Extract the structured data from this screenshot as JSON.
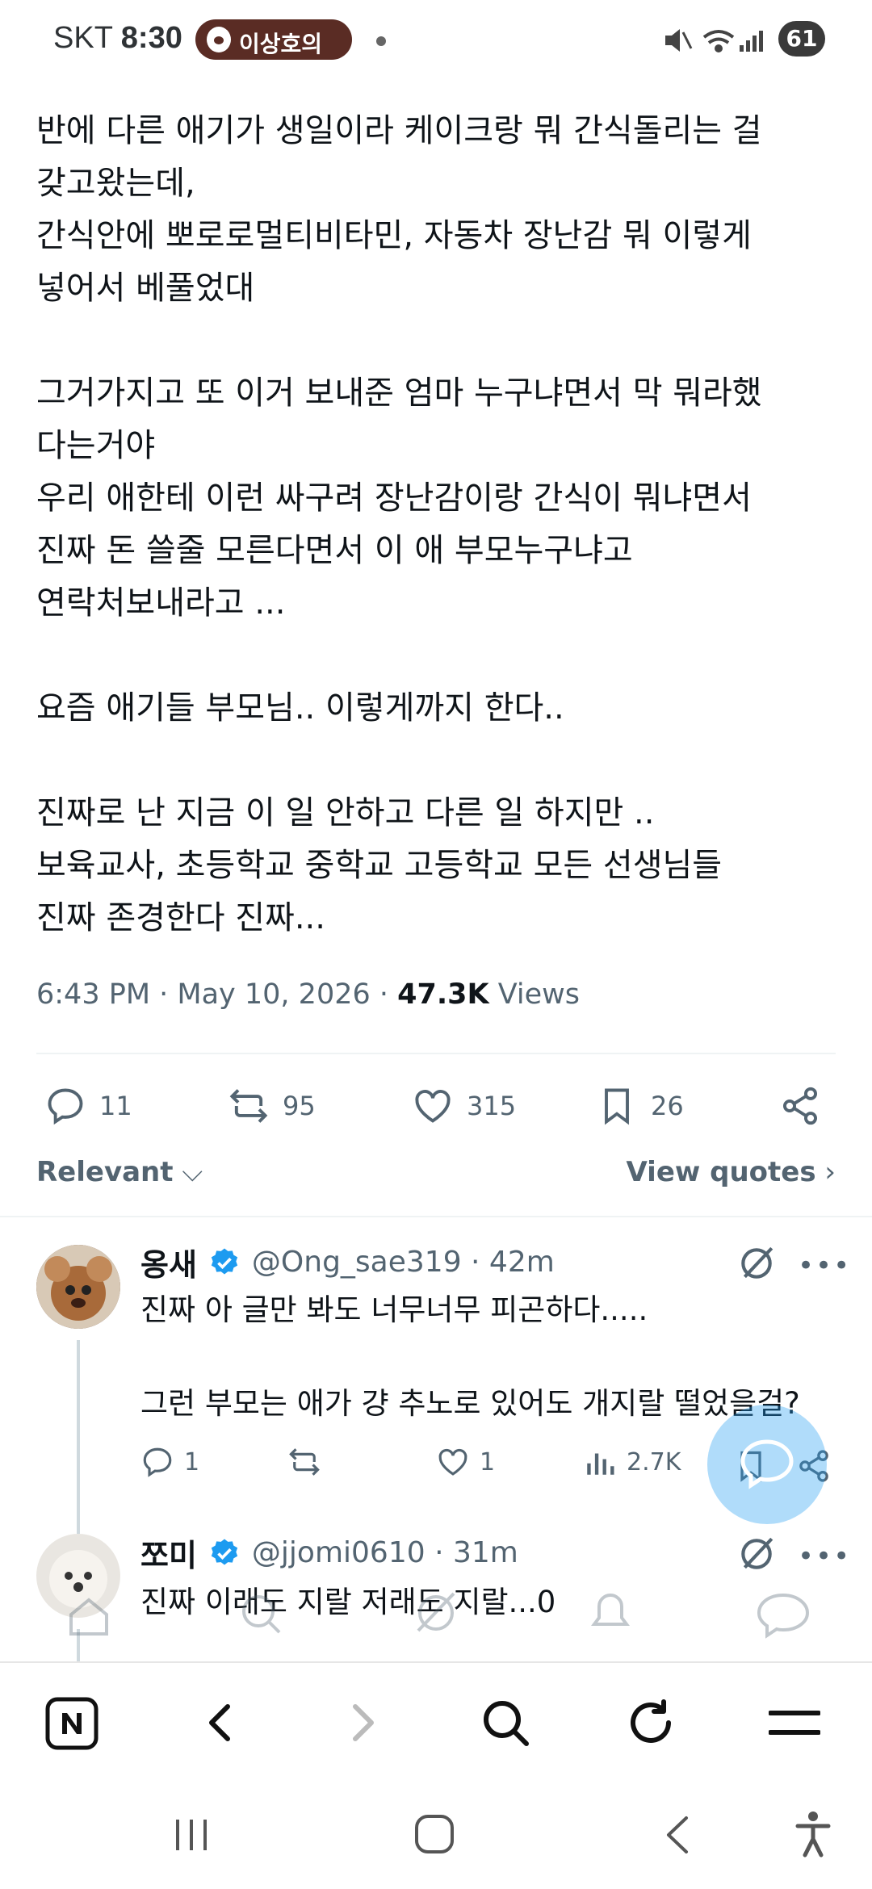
{
  "status_bar": {
    "carrier": "SKT",
    "time": "8:30",
    "notification_pill": "이상호의",
    "battery": "61"
  },
  "tweet": {
    "text": "반에 다른 애기가 생일이라 케이크랑 뭐 간식돌리는 걸\n갖고왔는데,\n간식안에 뽀로로멀티비타민, 자동차 장난감 뭐 이렇게\n넣어서 베풀었대\n\n그거가지고 또 이거 보내준 엄마 누구냐면서 막 뭐라했\n다는거야\n우리 애한테 이런 싸구려 장난감이랑 간식이 뭐냐면서\n진짜 돈 쓸줄 모른다면서 이 애 부모누구냐고\n연락처보내라고 ...\n\n요즘 애기들 부모님.. 이렇게까지 한다..\n\n진짜로 난 지금 이 일 안하고 다른 일 하지만 ..\n보육교사, 초등학교 중학교 고등학교 모든 선생님들\n진짜 존경한다 진짜...",
    "timestamp": "6:43 PM · May 10, 2026 · ",
    "views_count": "47.3K",
    "views_label": " Views",
    "replies": "11",
    "reposts": "95",
    "likes": "315",
    "bookmarks": "26"
  },
  "sort": {
    "label": "Relevant",
    "view_quotes": "View quotes"
  },
  "replies": [
    {
      "name": "옹새",
      "handle_time": "@Ong_sae319 · 42m",
      "text": "진짜 아 글만 봐도 너무너무 피곤하다.....\n\n그런 부모는 애가 걍 추노로 있어도 개지랄 떨었을걸?",
      "replies": "1",
      "reposts": "",
      "likes": "1",
      "views": "2.7K"
    },
    {
      "name": "쪼미",
      "handle_time": "@jjomi0610 · 31m",
      "text": "진짜 이래도 지랄 저래도 지랄...0"
    }
  ],
  "colors": {
    "accent": "#1d9bf0",
    "text": "#0f1419",
    "muted": "#536471",
    "verified": "#1d9bf0"
  },
  "icons": [
    "reply-icon",
    "repost-icon",
    "like-icon",
    "bookmark-icon",
    "share-icon",
    "grok-icon",
    "more-icon",
    "views-icon",
    "home-icon",
    "search-icon",
    "notifications-icon",
    "messages-icon",
    "naver-icon",
    "back-icon",
    "forward-icon",
    "reload-icon",
    "menu-icon"
  ]
}
